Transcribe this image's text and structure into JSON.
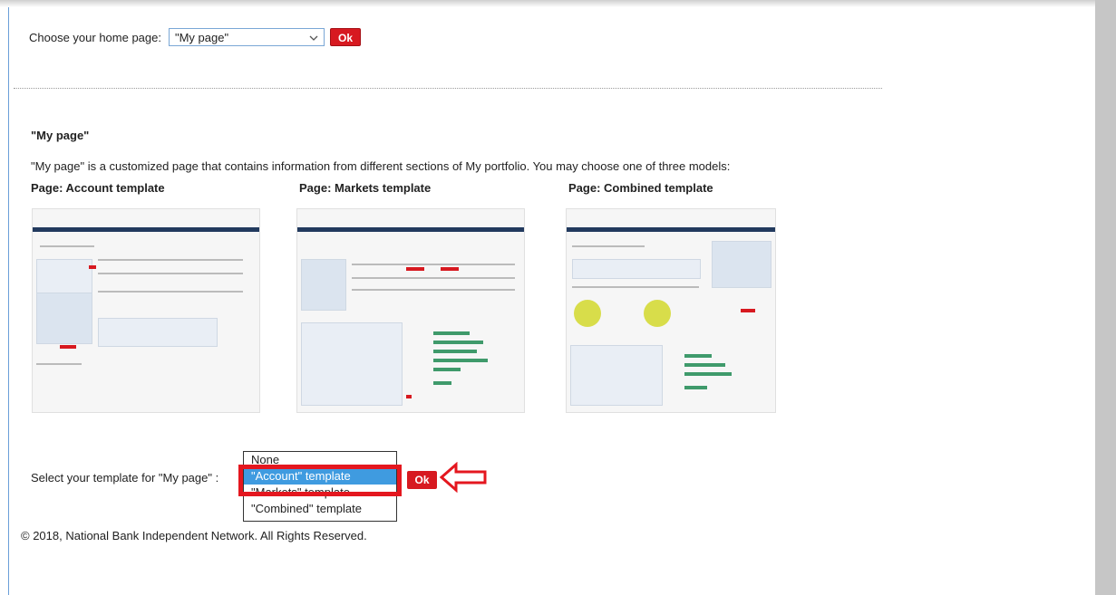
{
  "home": {
    "label": "Choose your home page:",
    "selected": "\"My page\"",
    "ok_label": "Ok"
  },
  "section": {
    "heading": "\"My page\"",
    "description": "\"My page\" is a customized page that contains information from different sections of My portfolio. You may choose one of three models:"
  },
  "templates": [
    {
      "title": "Page: Account template"
    },
    {
      "title": "Page: Markets template"
    },
    {
      "title": "Page: Combined template"
    }
  ],
  "template_select": {
    "label": "Select your template for \"My page\" :",
    "options": [
      "None",
      "\"Account\" template",
      "\"Markets\" template",
      "\"Combined\" template"
    ],
    "selected": "\"Account\" template",
    "ok_label": "Ok"
  },
  "footer": "© 2018, National Bank Independent Network. All Rights Reserved.",
  "colors": {
    "accent": "#d71920",
    "highlight": "#e4171f",
    "selection": "#3f9be0"
  }
}
